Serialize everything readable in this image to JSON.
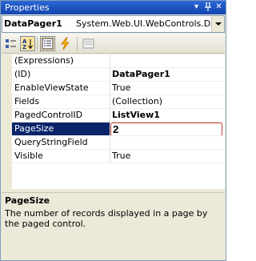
{
  "window": {
    "title": "Properties"
  },
  "object": {
    "name": "DataPager1",
    "type": "System.Web.UI.WebControls.DataPage"
  },
  "toolbar": {
    "buttons": [
      {
        "icon": "categorized-icon"
      },
      {
        "icon": "alphabetical-icon",
        "pressed": true
      },
      {
        "icon": "properties-icon",
        "pressed": true
      },
      {
        "icon": "events-icon"
      },
      {
        "icon": "property-pages-icon"
      }
    ]
  },
  "grid": {
    "rows": [
      {
        "name": "(Expressions)",
        "value": ""
      },
      {
        "name": "(ID)",
        "value": "DataPager1"
      },
      {
        "name": "EnableViewState",
        "value": "True"
      },
      {
        "name": "Fields",
        "value": "(Collection)"
      },
      {
        "name": "PagedControlID",
        "value": "ListView1"
      },
      {
        "name": "PageSize",
        "value": "2"
      },
      {
        "name": "QueryStringField",
        "value": ""
      },
      {
        "name": "Visible",
        "value": "True"
      }
    ]
  },
  "description": {
    "title": "PageSize",
    "text": "The number of records displayed in a page by the paged control."
  },
  "colors": {
    "titlebar": "#1d54c0",
    "selection": "#0a246a",
    "edit_border": "#c0392b"
  }
}
